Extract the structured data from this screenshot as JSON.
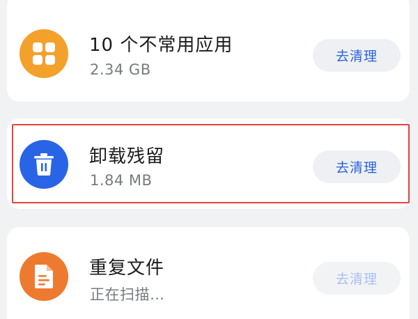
{
  "items": [
    {
      "title": "10 个不常用应用",
      "subtitle": "2.34 GB",
      "button": "去清理",
      "icon": "apps-grid-icon",
      "icon_color": "#f3a12b"
    },
    {
      "title": "卸载残留",
      "subtitle": "1.84 MB",
      "button": "去清理",
      "icon": "trash-icon",
      "icon_color": "#2964e6"
    },
    {
      "title": "重复文件",
      "subtitle": "正在扫描…",
      "button": "去清理",
      "icon": "document-icon",
      "icon_color": "#ee7a2f"
    }
  ],
  "colors": {
    "accent": "#2a63d8",
    "highlight_border": "#e8413b",
    "background": "#f1f2f4"
  }
}
